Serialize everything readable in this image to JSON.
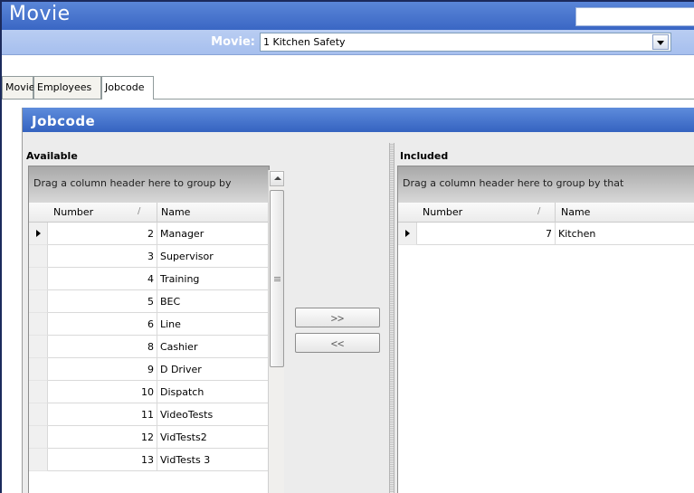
{
  "window": {
    "title": "Movie"
  },
  "selector": {
    "label": "Movie:",
    "value": "1 Kitchen Safety"
  },
  "tabs": [
    {
      "label": "Movie",
      "active": false
    },
    {
      "label": "Employees",
      "active": false
    },
    {
      "label": "Jobcode",
      "active": true
    }
  ],
  "panel": {
    "title": "Jobcode"
  },
  "available": {
    "label": "Available",
    "group_hint": "Drag a column header here to group by",
    "columns": {
      "number": "Number",
      "name": "Name"
    },
    "rows": [
      {
        "number": "2",
        "name": "Manager"
      },
      {
        "number": "3",
        "name": "Supervisor"
      },
      {
        "number": "4",
        "name": "Training"
      },
      {
        "number": "5",
        "name": "BEC"
      },
      {
        "number": "6",
        "name": "Line"
      },
      {
        "number": "8",
        "name": "Cashier"
      },
      {
        "number": "9",
        "name": "D Driver"
      },
      {
        "number": "10",
        "name": "Dispatch"
      },
      {
        "number": "11",
        "name": "VideoTests"
      },
      {
        "number": "12",
        "name": "VidTests2"
      },
      {
        "number": "13",
        "name": "VidTests 3"
      }
    ]
  },
  "buttons": {
    "add": ">>",
    "remove": "<<"
  },
  "included": {
    "label": "Included",
    "group_hint": "Drag a column header here to group by that",
    "columns": {
      "number": "Number",
      "name": "Name"
    },
    "rows": [
      {
        "number": "7",
        "name": "Kitchen"
      }
    ]
  },
  "colors": {
    "title_bar": "#3a67c4",
    "panel_header": "#3563c0",
    "selector_bar": "#a6bfee"
  }
}
